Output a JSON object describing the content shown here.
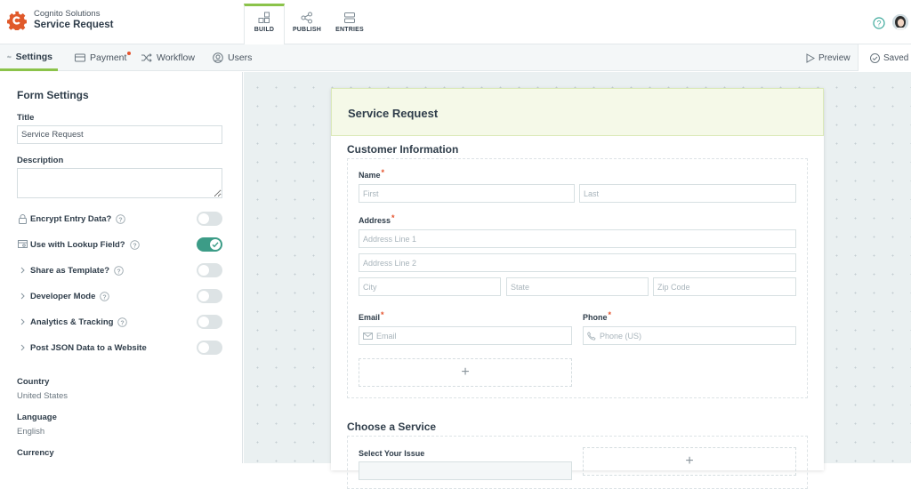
{
  "header": {
    "org_name": "Cognito Solutions",
    "form_name": "Service Request",
    "main_tabs": [
      {
        "label": "BUILD",
        "icon": "build-grid-icon",
        "active": true
      },
      {
        "label": "PUBLISH",
        "icon": "share-icon",
        "active": false
      },
      {
        "label": "ENTRIES",
        "icon": "entries-icon",
        "active": false
      }
    ],
    "help_icon": "help-circle-icon",
    "avatar": "user-avatar"
  },
  "subnav": {
    "tabs": [
      {
        "label": "Settings",
        "icon": "sliders-icon",
        "active": true
      },
      {
        "label": "Payment",
        "icon": "card-icon",
        "has_alert_dot": true
      },
      {
        "label": "Workflow",
        "icon": "shuffle-icon"
      },
      {
        "label": "Users",
        "icon": "user-circle-icon"
      }
    ],
    "preview_label": "Preview",
    "saved_label": "Saved"
  },
  "sidebar": {
    "title": "Form Settings",
    "title_label": "Title",
    "title_value": "Service Request",
    "description_label": "Description",
    "description_value": "",
    "toggles": [
      {
        "label": "Encrypt Entry Data?",
        "lead_icon": "lock-icon",
        "help": true,
        "on": false
      },
      {
        "label": "Use with Lookup Field?",
        "lead_icon": "lookup-icon",
        "help": true,
        "on": true
      },
      {
        "label": "Share as Template?",
        "lead_icon": "chevron-right-icon",
        "help": true,
        "on": false
      },
      {
        "label": "Developer Mode",
        "lead_icon": "chevron-right-icon",
        "help": true,
        "on": false
      },
      {
        "label": "Analytics & Tracking",
        "lead_icon": "chevron-right-icon",
        "help": true,
        "on": false
      },
      {
        "label": "Post JSON Data to a Website",
        "lead_icon": "chevron-right-icon",
        "help": false,
        "on": false
      }
    ],
    "country_label": "Country",
    "country_value": "United States",
    "language_label": "Language",
    "language_value": "English",
    "currency_label": "Currency"
  },
  "form": {
    "title": "Service Request",
    "sections": [
      {
        "title": "Customer Information",
        "fields": {
          "name_label": "Name",
          "name_first_placeholder": "First",
          "name_last_placeholder": "Last",
          "address_label": "Address",
          "address_line1_placeholder": "Address Line 1",
          "address_line2_placeholder": "Address Line 2",
          "city_placeholder": "City",
          "state_placeholder": "State",
          "zip_placeholder": "Zip Code",
          "email_label": "Email",
          "email_placeholder": "Email",
          "phone_label": "Phone",
          "phone_placeholder": "Phone (US)",
          "required_marker": "*"
        },
        "add_field_symbol": "+"
      },
      {
        "title": "Choose a Service",
        "fields": {
          "issue_label": "Select Your Issue"
        },
        "add_field_symbol": "+"
      }
    ]
  },
  "colors": {
    "accent_green": "#8bc34a",
    "toggle_on": "#3c9c87",
    "required_red": "#e5532d",
    "brand_orange": "#e0592a",
    "header_band": "#f5f9e8"
  }
}
